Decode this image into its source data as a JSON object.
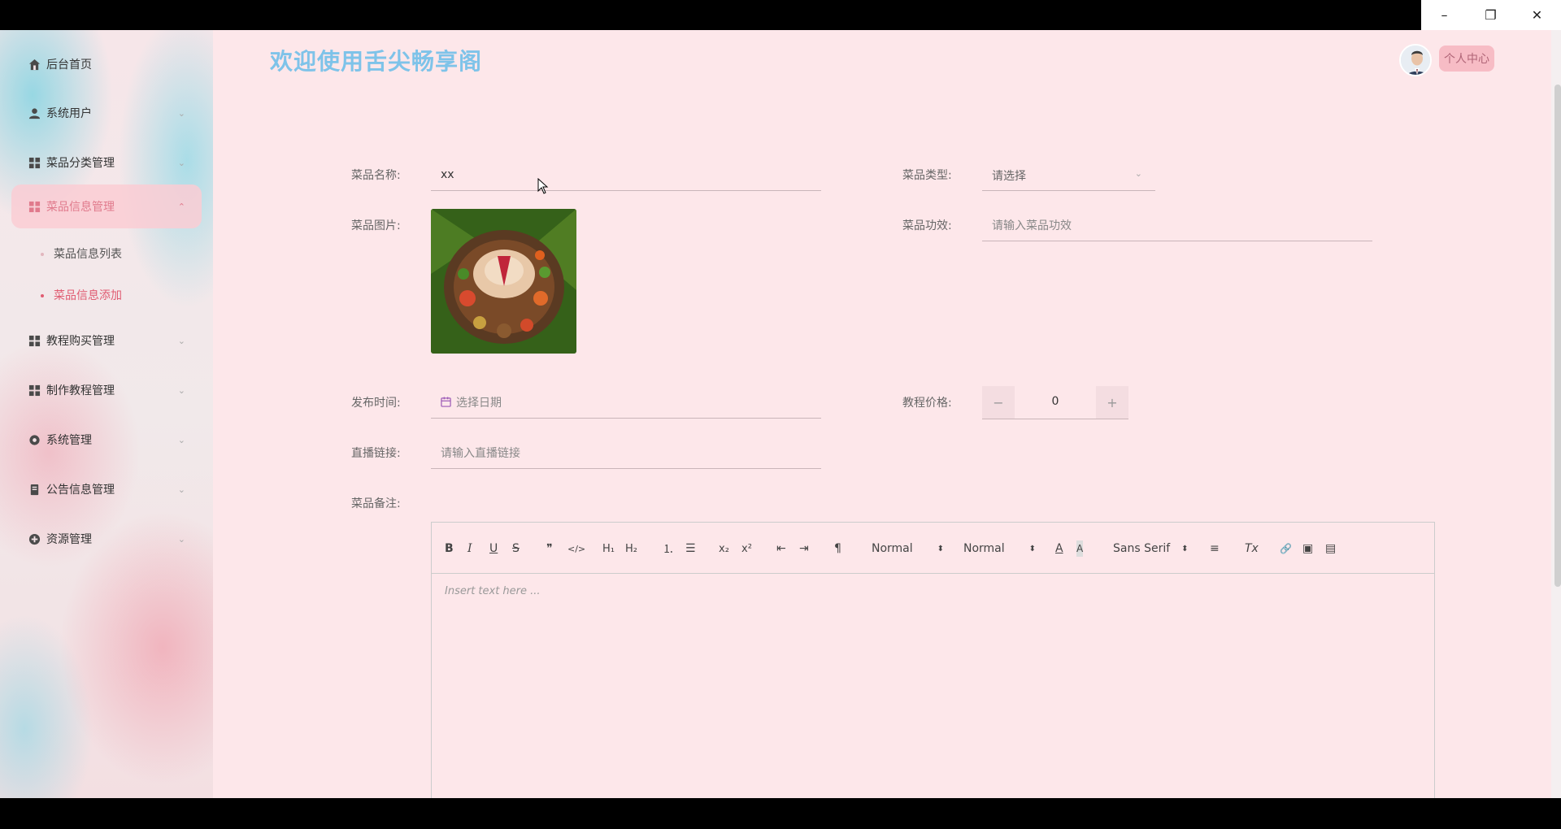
{
  "window": {
    "minimize_icon": "–",
    "restore_icon": "❐",
    "close_icon": "✕"
  },
  "sidebar": {
    "items": [
      {
        "label": "后台首页",
        "icon": "home-icon"
      },
      {
        "label": "系统用户",
        "icon": "user-icon"
      },
      {
        "label": "菜品分类管理",
        "icon": "grid-icon"
      },
      {
        "label": "菜品信息管理",
        "icon": "grid-icon"
      },
      {
        "label": "教程购买管理",
        "icon": "grid-icon"
      },
      {
        "label": "制作教程管理",
        "icon": "grid-icon"
      },
      {
        "label": "系统管理",
        "icon": "gear-icon"
      },
      {
        "label": "公告信息管理",
        "icon": "document-icon"
      },
      {
        "label": "资源管理",
        "icon": "plus-circle-icon"
      }
    ],
    "subitems": [
      {
        "label": "菜品信息列表"
      },
      {
        "label": "菜品信息添加"
      }
    ]
  },
  "header": {
    "title": "欢迎使用舌尖畅享阁",
    "profile_label": "个人中心"
  },
  "form": {
    "name_label": "菜品名称:",
    "name_value": "xx",
    "type_label": "菜品类型:",
    "type_placeholder": "请选择",
    "image_label": "菜品图片:",
    "effect_label": "菜品功效:",
    "effect_placeholder": "请输入菜品功效",
    "time_label": "发布时间:",
    "time_placeholder": "选择日期",
    "price_label": "教程价格:",
    "price_value": "0",
    "link_label": "直播链接:",
    "link_placeholder": "请输入直播链接",
    "notes_label": "菜品备注:"
  },
  "editor": {
    "toolbar": {
      "bold": "B",
      "italic": "I",
      "underline": "U",
      "strike": "S",
      "quote": "❞",
      "code": "</>",
      "h1": "H₁",
      "h2": "H₂",
      "ordered_list": "⒈",
      "bullet_list": "☰",
      "subscript": "x₂",
      "superscript": "x²",
      "outdent": "⇤",
      "indent": "⇥",
      "direction": "¶",
      "size_picker": "Normal",
      "header_picker": "Normal",
      "font_picker": "Sans Serif",
      "color": "A",
      "background": "A",
      "align": "≡",
      "clean": "Tx",
      "link": "🔗",
      "image": "▣",
      "video": "▤"
    },
    "placeholder": "Insert text here ..."
  },
  "colors": {
    "accent": "#e05c72",
    "title": "#7ec3e9",
    "background": "#fde7ea"
  }
}
